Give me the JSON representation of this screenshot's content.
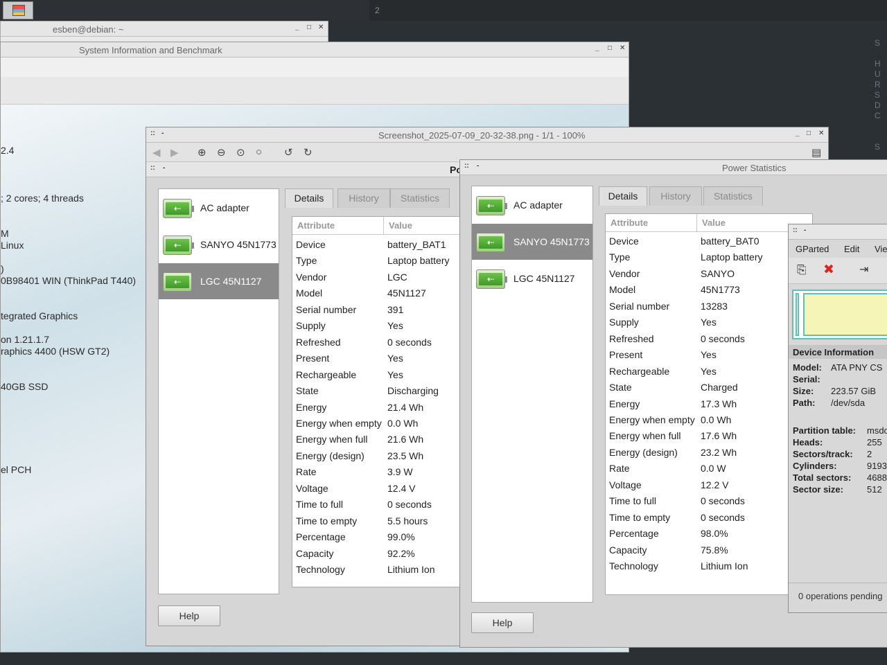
{
  "panel": {
    "workspace": "2"
  },
  "right_terminal": {
    "lines": [
      "S",
      "",
      "H",
      "U",
      "R",
      "S",
      "D",
      "C",
      "",
      "",
      "S"
    ]
  },
  "terminal": {
    "title": "esben@debian: ~"
  },
  "sysinfo": {
    "title": "System Information and Benchmark",
    "lines": [
      {
        "text": "2.4",
        "y": 0
      },
      {
        "text": "; 2 cores; 4 threads",
        "y": 1
      },
      {
        "text": "M",
        "y": 2
      },
      {
        "text": "Linux",
        "y": 3
      },
      {
        "text": ")",
        "y": 4
      },
      {
        "text": "0B98401 WIN (ThinkPad T440)",
        "y": 5
      },
      {
        "text": "tegrated Graphics",
        "y": 6
      },
      {
        "text": "on 1.21.1.7",
        "y": 7
      },
      {
        "text": "raphics 4400 (HSW GT2)",
        "y": 8
      },
      {
        "text": "40GB SSD",
        "y": 9
      },
      {
        "text": "el PCH",
        "y": 10
      }
    ]
  },
  "viewer": {
    "title": "Screenshot_2025-07-09_20-32-38.png - 1/1 - 100%",
    "partial_title": "Po"
  },
  "power1": {
    "devices": [
      {
        "label": "AC adapter",
        "selected": false
      },
      {
        "label": "SANYO 45N1773",
        "selected": false
      },
      {
        "label": "LGC 45N1127",
        "selected": true
      }
    ],
    "tabs": [
      {
        "label": "Details",
        "active": true
      },
      {
        "label": "History",
        "active": false
      },
      {
        "label": "Statistics",
        "active": false
      }
    ],
    "columns": {
      "attr": "Attribute",
      "value": "Value"
    },
    "rows": [
      [
        "Device",
        "battery_BAT1"
      ],
      [
        "Type",
        "Laptop battery"
      ],
      [
        "Vendor",
        "LGC"
      ],
      [
        "Model",
        "45N1127"
      ],
      [
        "Serial number",
        "391"
      ],
      [
        "Supply",
        "Yes"
      ],
      [
        "Refreshed",
        "0 seconds"
      ],
      [
        "Present",
        "Yes"
      ],
      [
        "Rechargeable",
        "Yes"
      ],
      [
        "State",
        "Discharging"
      ],
      [
        "Energy",
        "21.4 Wh"
      ],
      [
        "Energy when empty",
        "0.0 Wh"
      ],
      [
        "Energy when full",
        "21.6 Wh"
      ],
      [
        "Energy (design)",
        "23.5 Wh"
      ],
      [
        "Rate",
        "3.9 W"
      ],
      [
        "Voltage",
        "12.4 V"
      ],
      [
        "Time to full",
        "0 seconds"
      ],
      [
        "Time to empty",
        "5.5 hours"
      ],
      [
        "Percentage",
        "99.0%"
      ],
      [
        "Capacity",
        "92.2%"
      ],
      [
        "Technology",
        "Lithium Ion"
      ]
    ],
    "help": "Help"
  },
  "power2": {
    "title": "Power Statistics",
    "devices": [
      {
        "label": "AC adapter",
        "selected": false
      },
      {
        "label": "SANYO 45N1773",
        "selected": true
      },
      {
        "label": "LGC 45N1127",
        "selected": false
      }
    ],
    "tabs": [
      {
        "label": "Details",
        "active": true
      },
      {
        "label": "History",
        "active": false
      },
      {
        "label": "Statistics",
        "active": false
      }
    ],
    "columns": {
      "attr": "Attribute",
      "value": "Value"
    },
    "rows": [
      [
        "Device",
        "battery_BAT0"
      ],
      [
        "Type",
        "Laptop battery"
      ],
      [
        "Vendor",
        "SANYO"
      ],
      [
        "Model",
        "45N1773"
      ],
      [
        "Serial number",
        "13283"
      ],
      [
        "Supply",
        "Yes"
      ],
      [
        "Refreshed",
        "0 seconds"
      ],
      [
        "Present",
        "Yes"
      ],
      [
        "Rechargeable",
        "Yes"
      ],
      [
        "State",
        "Charged"
      ],
      [
        "Energy",
        "17.3 Wh"
      ],
      [
        "Energy when empty",
        "0.0 Wh"
      ],
      [
        "Energy when full",
        "17.6 Wh"
      ],
      [
        "Energy (design)",
        "23.2 Wh"
      ],
      [
        "Rate",
        "0.0 W"
      ],
      [
        "Voltage",
        "12.2 V"
      ],
      [
        "Time to full",
        "0 seconds"
      ],
      [
        "Time to empty",
        "0 seconds"
      ],
      [
        "Percentage",
        "98.0%"
      ],
      [
        "Capacity",
        "75.8%"
      ],
      [
        "Technology",
        "Lithium Ion"
      ]
    ],
    "help": "Help"
  },
  "gparted": {
    "menu": [
      "GParted",
      "Edit",
      "Vie"
    ],
    "section": "Device Information",
    "model_label": "Model:",
    "model": "ATA PNY CS",
    "serial_label": "Serial:",
    "size_label": "Size:",
    "size": "223.57 GiB",
    "path_label": "Path:",
    "path": "/dev/sda",
    "ptable_label": "Partition table:",
    "ptable": "msdo",
    "heads_label": "Heads:",
    "heads": "255",
    "sectors_label": "Sectors/track:",
    "sectors": "2",
    "cyl_label": "Cylinders:",
    "cyl": "9193",
    "total_label": "Total sectors:",
    "total": "4688",
    "ssize_label": "Sector size:",
    "ssize": "512",
    "status": "0 operations pending"
  }
}
